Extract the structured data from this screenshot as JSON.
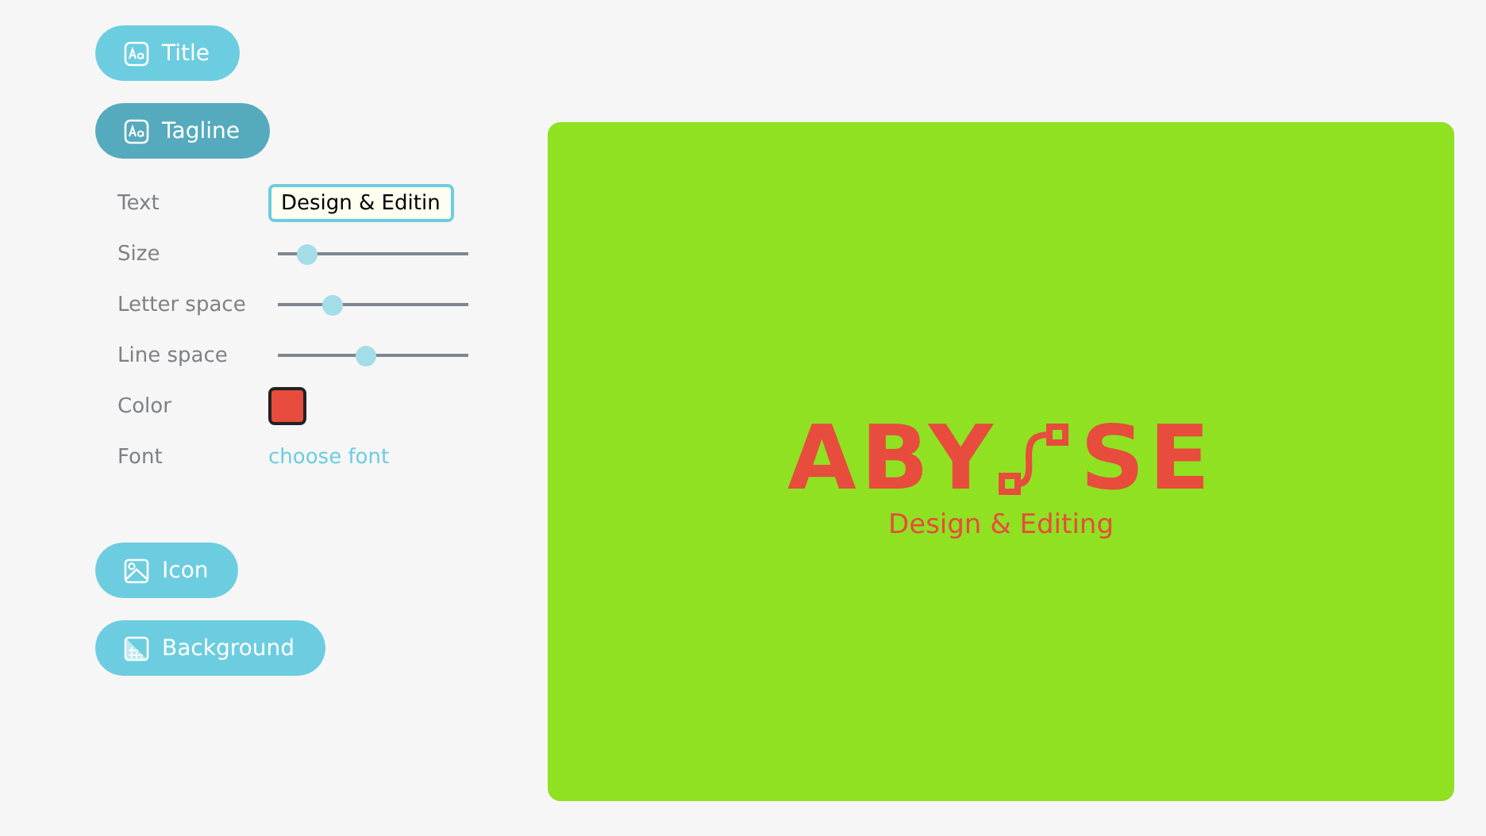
{
  "sections": [
    {
      "label": "Title",
      "kind": "text",
      "selected": false
    },
    {
      "label": "Tagline",
      "kind": "text",
      "selected": true,
      "settings": [
        {
          "label": "Text",
          "kind": "text",
          "value": "Design & Editin"
        },
        {
          "label": "Size",
          "kind": "slider",
          "level": 0.15
        },
        {
          "label": "Letter space",
          "kind": "slider",
          "level": 0.28
        },
        {
          "label": "Line space",
          "kind": "slider",
          "level": 0.46
        },
        {
          "label": "Color",
          "kind": "color",
          "color": "#e74c3c"
        },
        {
          "label": "Font",
          "kind": "link",
          "value": "choose font"
        }
      ]
    },
    {
      "label": "Icon",
      "kind": "image",
      "selected": false
    },
    {
      "label": "Background",
      "kind": "background",
      "selected": false
    }
  ],
  "preview": {
    "logo_start": "ABY",
    "logo_end": "SE",
    "tagline": "Design & Editing"
  }
}
